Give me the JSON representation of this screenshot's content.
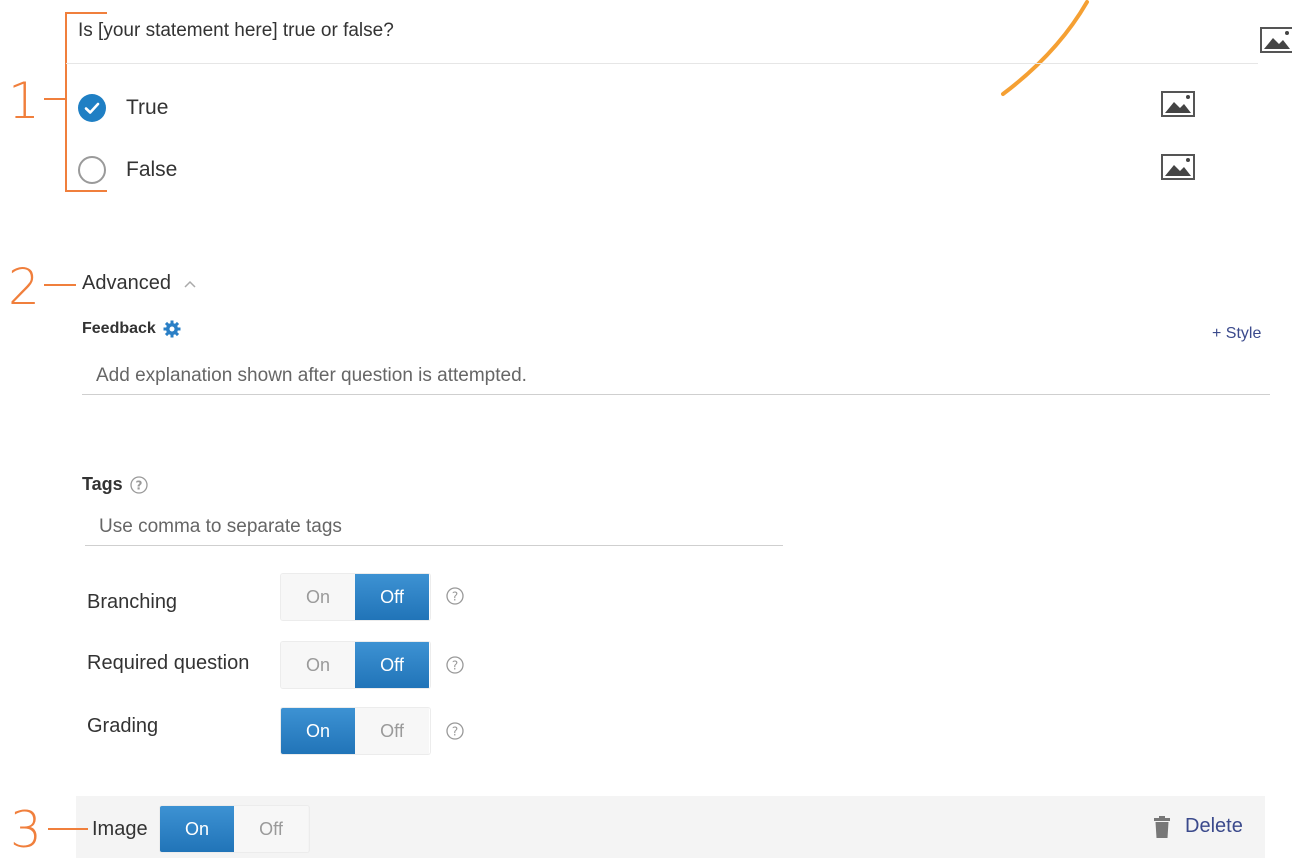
{
  "question": {
    "text": "Is [your statement here] true or false?",
    "options": [
      {
        "label": "True",
        "checked": true
      },
      {
        "label": "False",
        "checked": false
      }
    ]
  },
  "markers": {
    "one": "1",
    "two": "2",
    "three": "3"
  },
  "advanced": {
    "title": "Advanced",
    "feedback_label": "Feedback",
    "style_link": "+ Style",
    "feedback_placeholder": "Add explanation shown after question is attempted."
  },
  "tags": {
    "label": "Tags",
    "placeholder": "Use comma to separate tags"
  },
  "settings": [
    {
      "label": "Branching",
      "on": "On",
      "off": "Off",
      "value": "Off"
    },
    {
      "label": "Required question",
      "on": "On",
      "off": "Off",
      "value": "Off"
    },
    {
      "label": "Grading",
      "on": "On",
      "off": "Off",
      "value": "On"
    }
  ],
  "image_bar": {
    "label": "Image",
    "on": "On",
    "off": "Off",
    "value": "On",
    "delete_label": "Delete"
  },
  "colors": {
    "accent": "#1f7fc4",
    "annotation": "#f07f3c",
    "link": "#3b4a8c"
  },
  "icons": [
    "image-icon",
    "check-icon",
    "chevron-up-icon",
    "gear-icon",
    "help-icon",
    "trash-icon",
    "arrow-annotation-icon"
  ]
}
